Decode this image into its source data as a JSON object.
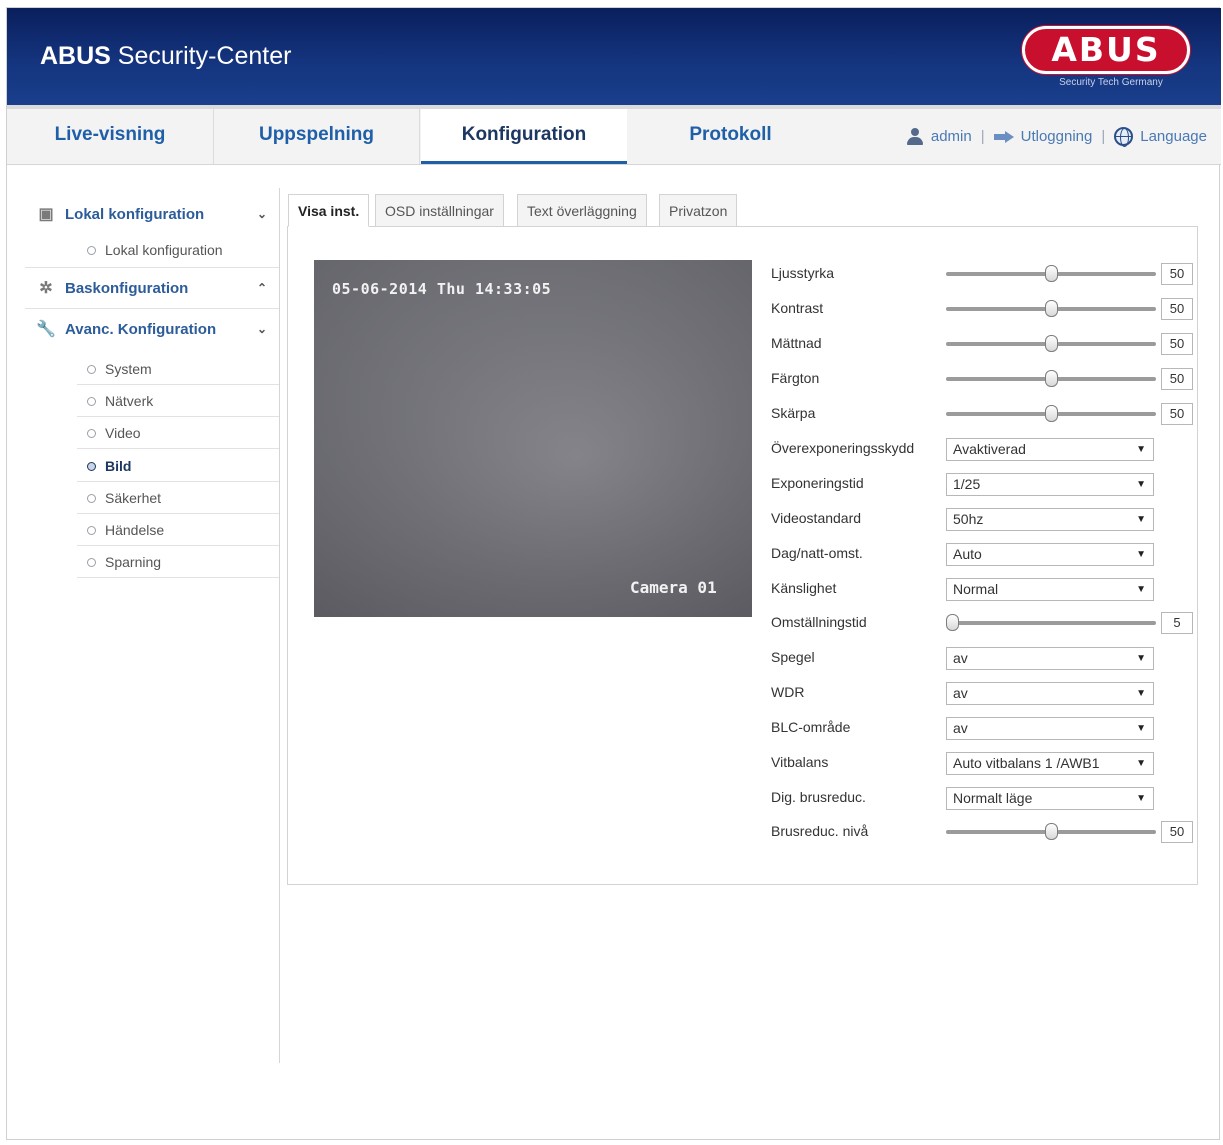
{
  "header": {
    "brand_bold": "ABUS",
    "brand_rest": "Security-Center",
    "logo_text": "ABUS",
    "logo_sub": "Security Tech Germany",
    "accent": "#c8102e",
    "header_color": "#14347e"
  },
  "nav": {
    "tabs": [
      {
        "label": "Live-visning"
      },
      {
        "label": "Uppspelning"
      },
      {
        "label": "Konfiguration"
      },
      {
        "label": "Protokoll"
      }
    ],
    "active_tab": "Konfiguration",
    "user": "admin",
    "logout": "Utloggning",
    "language": "Language",
    "separator": "|"
  },
  "sidebar": {
    "sections": [
      {
        "label": "Lokal konfiguration",
        "icon": "computer-icon",
        "chevron": "⌄"
      },
      {
        "label": "Baskonfiguration",
        "icon": "gear-icon",
        "chevron": "⌃"
      },
      {
        "label": "Avanc. Konfiguration",
        "icon": "wrench-icon",
        "chevron": "⌄"
      }
    ],
    "local_items": [
      "Lokal konfiguration"
    ],
    "advanced_items": [
      "System",
      "Nätverk",
      "Video",
      "Bild",
      "Säkerhet",
      "Händelse",
      "Sparning"
    ],
    "active_item": "Bild"
  },
  "subtabs": [
    "Visa inst.",
    "OSD inställningar",
    "Text överläggning",
    "Privatzon"
  ],
  "active_subtab": "Visa inst.",
  "video": {
    "timestamp": "05-06-2014 Thu 14:33:05",
    "camera_name": "Camera 01"
  },
  "settings": {
    "brightness": {
      "label": "Ljusstyrka",
      "value": "50",
      "level": 0.5
    },
    "contrast": {
      "label": "Kontrast",
      "value": "50",
      "level": 0.5
    },
    "saturation": {
      "label": "Mättnad",
      "value": "50",
      "level": 0.5
    },
    "hue": {
      "label": "Färgton",
      "value": "50",
      "level": 0.5
    },
    "sharpness": {
      "label": "Skärpa",
      "value": "50",
      "level": 0.5
    },
    "overexposure": {
      "label": "Överexponeringsskydd",
      "value": "Avaktiverad"
    },
    "exposure_time": {
      "label": "Exponeringstid",
      "value": "1/25"
    },
    "video_standard": {
      "label": "Videostandard",
      "value": "50hz"
    },
    "day_night": {
      "label": "Dag/natt-omst.",
      "value": "Auto"
    },
    "sensitivity": {
      "label": "Känslighet",
      "value": "Normal"
    },
    "switch_time": {
      "label": "Omställningstid",
      "value": "5",
      "level": 0.0
    },
    "mirror": {
      "label": "Spegel",
      "value": "av"
    },
    "wdr": {
      "label": "WDR",
      "value": "av"
    },
    "blc": {
      "label": "BLC-område",
      "value": "av"
    },
    "white_balance": {
      "label": "Vitbalans",
      "value": "Auto vitbalans 1 /AWB1"
    },
    "dnr": {
      "label": "Dig. brusreduc.",
      "value": "Normalt läge"
    },
    "dnr_level": {
      "label": "Brusreduc. nivå",
      "value": "50",
      "level": 0.5
    },
    "dropdown_arrow": "▼"
  }
}
